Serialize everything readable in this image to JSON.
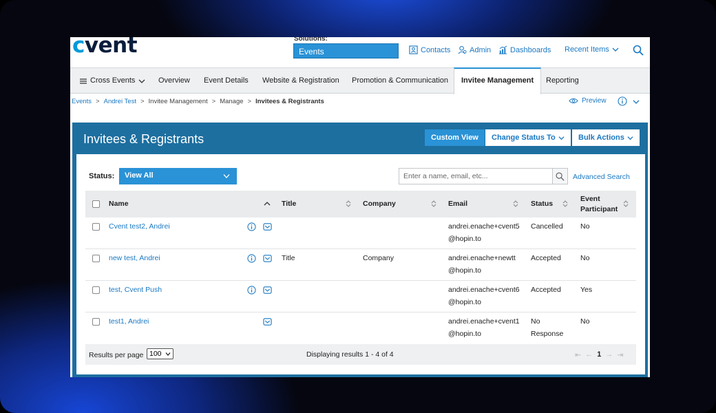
{
  "header": {
    "logo_c": "c",
    "logo_rest": "vent",
    "solutions_label": "Solutions:",
    "solutions_value": "Events",
    "links": {
      "contacts": "Contacts",
      "admin": "Admin",
      "dashboards": "Dashboards",
      "recent": "Recent Items"
    }
  },
  "nav": {
    "cross_events": "Cross Events",
    "items": [
      "Overview",
      "Event Details",
      "Website & Registration",
      "Promotion & Communication",
      "Invitee Management",
      "Reporting"
    ],
    "active": "Invitee Management"
  },
  "breadcrumb": {
    "items": [
      "Events",
      "Andrei Test",
      "Invitee Management",
      "Manage",
      "Invitees & Registrants"
    ],
    "separator": ">",
    "preview": "Preview"
  },
  "panel": {
    "title": "Invitees & Registrants",
    "custom_view": "Custom View",
    "change_status": "Change Status To",
    "bulk_actions": "Bulk Actions"
  },
  "filters": {
    "status_label": "Status:",
    "status_value": "View All",
    "search_placeholder": "Enter a name, email, etc...",
    "advanced_search": "Advanced Search"
  },
  "table": {
    "columns": [
      "Name",
      "Title",
      "Company",
      "Email",
      "Status",
      "Event Participant"
    ],
    "rows": [
      {
        "name": "Cvent test2, Andrei",
        "title": "",
        "company": "",
        "email_1": "andrei.enache+cvent5",
        "email_2": "@hopin.to",
        "status_1": "Cancelled",
        "status_2": "",
        "participant": "No"
      },
      {
        "name": "new test, Andrei",
        "title": "Title",
        "company": "Company",
        "email_1": "andrei.enache+newtt",
        "email_2": "@hopin.to",
        "status_1": "Accepted",
        "status_2": "",
        "participant": "No"
      },
      {
        "name": "test, Cvent Push",
        "title": "",
        "company": "",
        "email_1": "andrei.enache+cvent6",
        "email_2": "@hopin.to",
        "status_1": "Accepted",
        "status_2": "",
        "participant": "Yes"
      },
      {
        "name": "test1, Andrei",
        "title": "",
        "company": "",
        "email_1": "andrei.enache+cvent1",
        "email_2": "@hopin.to",
        "status_1": "No",
        "status_2": "Response",
        "participant": "No"
      }
    ]
  },
  "footer": {
    "results_per_page": "Results per page",
    "per_page_value": "100",
    "displaying": "Displaying results 1 - 4 of 4",
    "current_page": "1"
  },
  "colors": {
    "accent": "#2a92d6",
    "panel": "#1d6fa0",
    "link": "#1a78c2"
  }
}
